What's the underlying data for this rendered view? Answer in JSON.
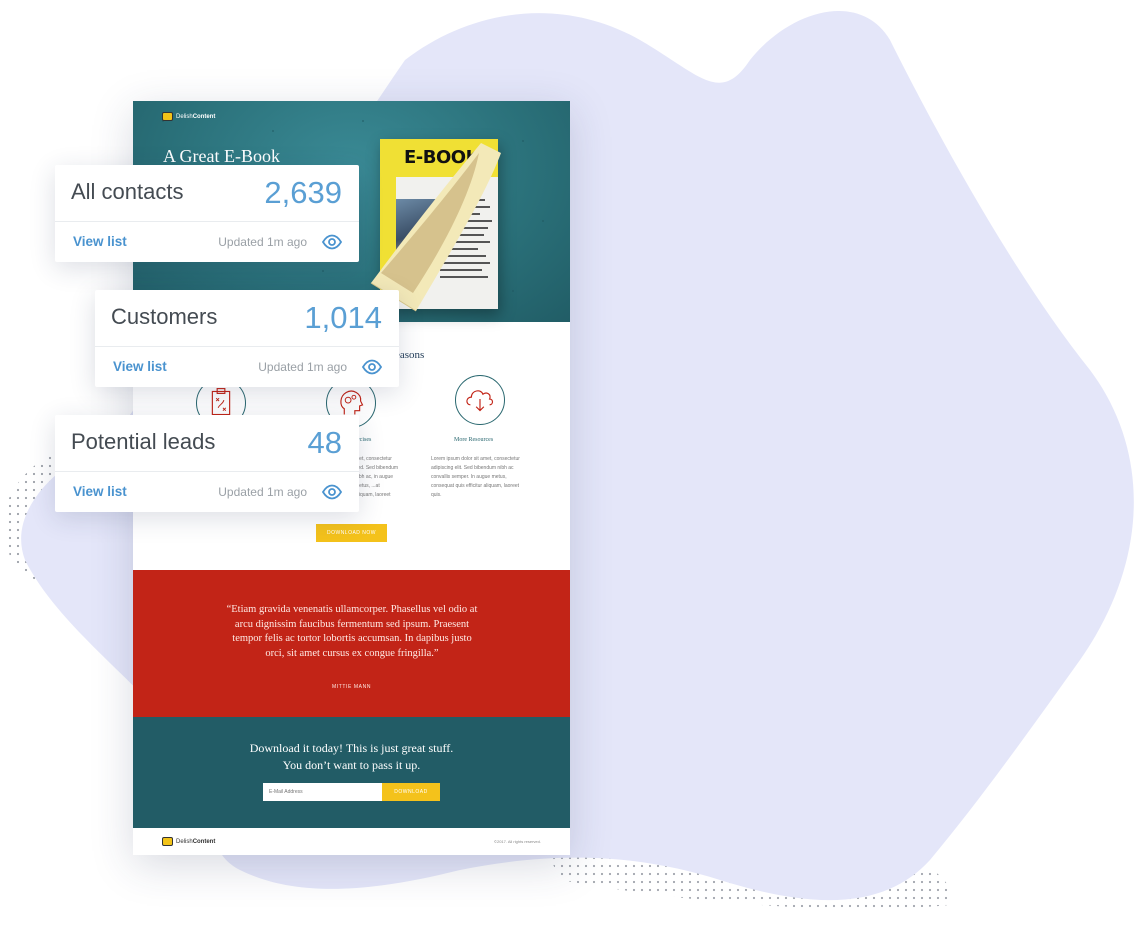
{
  "cards": [
    {
      "title": "All contacts",
      "count": "2,639",
      "link": "View list",
      "updated": "Updated 1m ago"
    },
    {
      "title": "Customers",
      "count": "1,014",
      "link": "View list",
      "updated": "Updated 1m ago"
    },
    {
      "title": "Potential leads",
      "count": "48",
      "link": "View list",
      "updated": "Updated 1m ago"
    }
  ],
  "landing": {
    "brand_prefix": "Delish",
    "brand_suffix": "Content",
    "hero_title": "A Great E-Book",
    "book_title": "E-BOOK",
    "section_title": "easons",
    "features": [
      {
        "label": "ercises",
        "desc": "...et, consectetur sed. Sed bibendum nibh ac, in augue metus, ...at aliquam, laoreet"
      },
      {
        "label": "More Resources",
        "desc": "Lorem ipsum dolor sit amet, consectetur adipiscing elit. Sed bibendum nibh ac convallis semper. In augue metus, consequat quis efficitur aliquam, laoreet quis."
      }
    ],
    "download_now": "DOWNLOAD NOW",
    "quote": "“Etiam gravida venenatis ullamcorper. Phasellus vel odio at arcu dignissim faucibus fermentum sed ipsum. Praesent tempor felis ac tortor lobortis accumsan. In dapibus justo orci, sit amet cursus ex congue fringilla.”",
    "quote_author": "MITTIE MANN",
    "cta_line1": "Download it today! This is just great stuff.",
    "cta_line2": "You don’t want to pass it up.",
    "email_placeholder": "E-Mail Address",
    "cta_button": "DOWNLOAD",
    "copyright": "©2017. All rights reserved."
  },
  "colors": {
    "accent_blue": "#5a9fd4",
    "teal": "#225c66",
    "quote_red": "#c22417",
    "cta_yellow": "#f4c21b",
    "blob": "#e4e6f9"
  },
  "icons": [
    "eye-icon",
    "clipboard-strategy-icon",
    "head-gears-icon",
    "cloud-download-icon"
  ]
}
